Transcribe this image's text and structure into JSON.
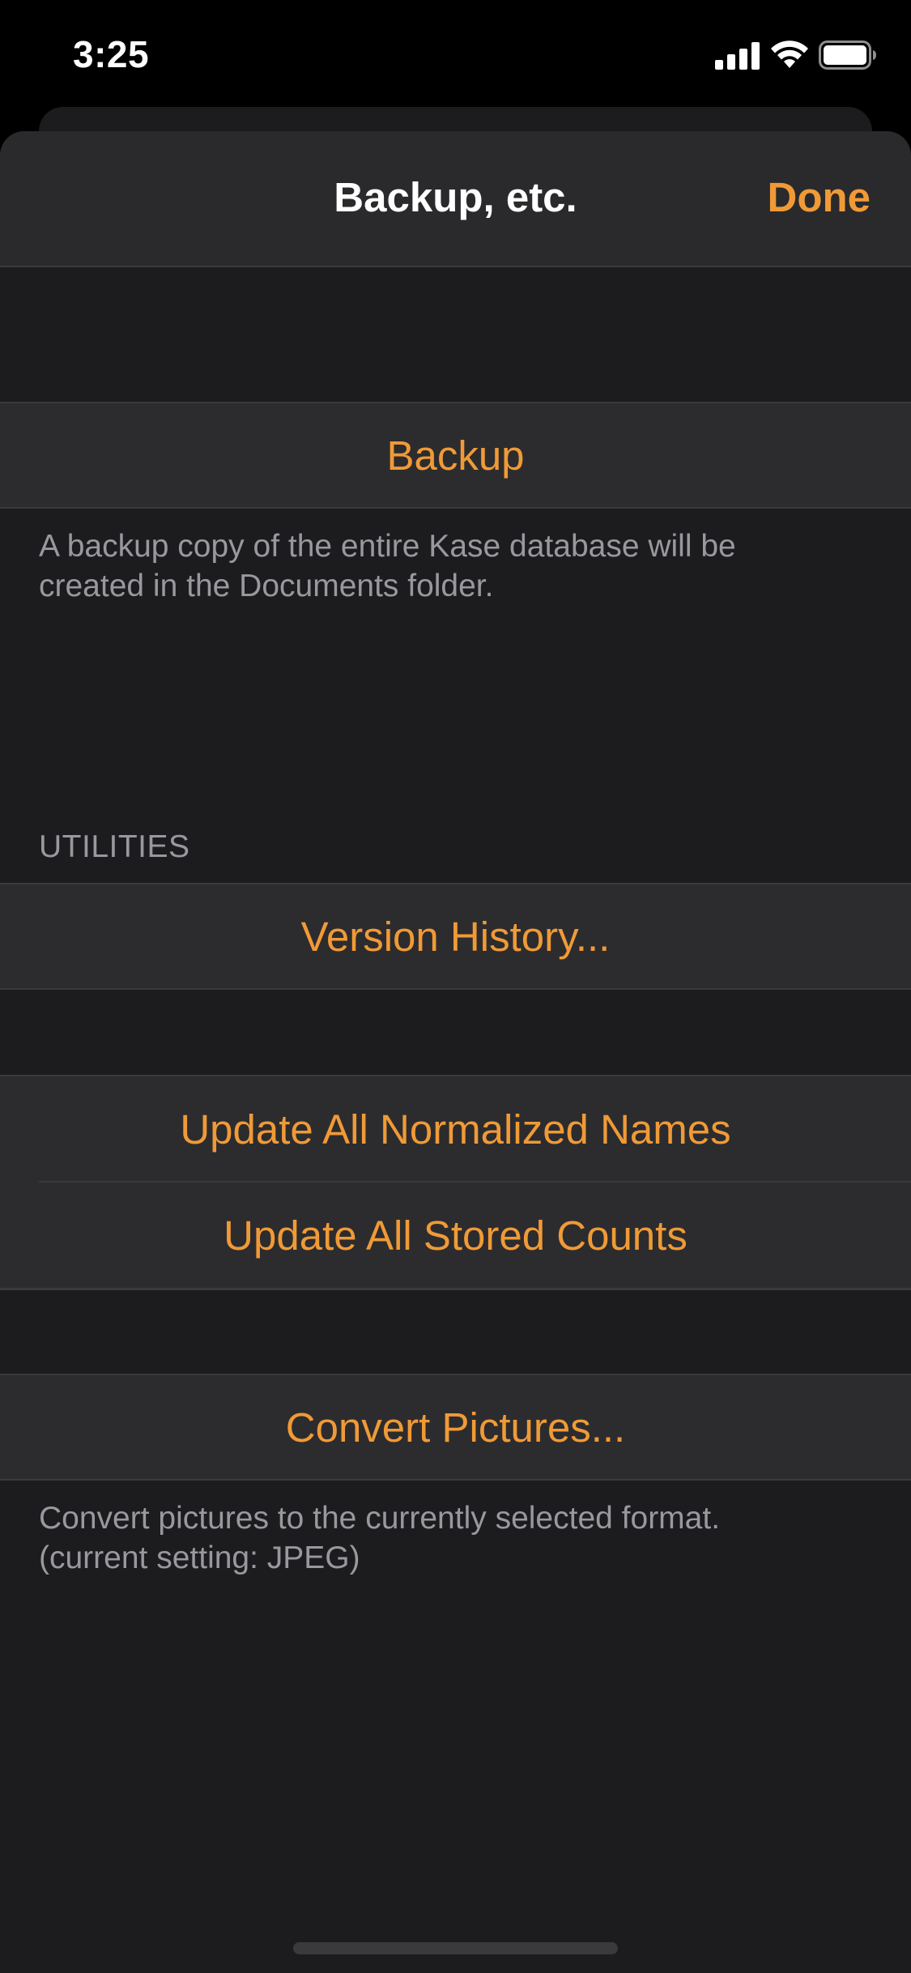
{
  "status_bar": {
    "time": "3:25",
    "icons": [
      "cellular-signal-icon",
      "wifi-icon",
      "battery-icon"
    ]
  },
  "nav": {
    "title": "Backup, etc.",
    "done_label": "Done"
  },
  "backup_section": {
    "button_label": "Backup",
    "footer_line1": "A backup copy of the entire Kase database will be",
    "footer_line2": "created in the Documents folder."
  },
  "utilities_section": {
    "header": "UTILITIES",
    "version_history_label": "Version History...",
    "update_normalized_label": "Update All Normalized Names",
    "update_counts_label": "Update All Stored Counts",
    "convert_pictures_label": "Convert Pictures...",
    "convert_footer_line1": "Convert pictures to the currently selected format.",
    "convert_footer_line2": "(current setting: JPEG)"
  },
  "colors": {
    "accent": "#f09a37",
    "background": "#1c1c1e",
    "cell": "#2c2c2e",
    "secondary_text": "#98989f"
  }
}
